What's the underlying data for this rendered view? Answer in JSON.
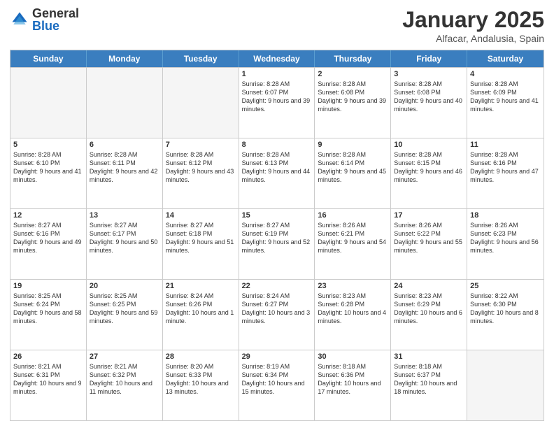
{
  "logo": {
    "general": "General",
    "blue": "Blue"
  },
  "title": "January 2025",
  "subtitle": "Alfacar, Andalusia, Spain",
  "weekdays": [
    "Sunday",
    "Monday",
    "Tuesday",
    "Wednesday",
    "Thursday",
    "Friday",
    "Saturday"
  ],
  "weeks": [
    [
      {
        "day": "",
        "info": ""
      },
      {
        "day": "",
        "info": ""
      },
      {
        "day": "",
        "info": ""
      },
      {
        "day": "1",
        "info": "Sunrise: 8:28 AM\nSunset: 6:07 PM\nDaylight: 9 hours and 39 minutes."
      },
      {
        "day": "2",
        "info": "Sunrise: 8:28 AM\nSunset: 6:08 PM\nDaylight: 9 hours and 39 minutes."
      },
      {
        "day": "3",
        "info": "Sunrise: 8:28 AM\nSunset: 6:08 PM\nDaylight: 9 hours and 40 minutes."
      },
      {
        "day": "4",
        "info": "Sunrise: 8:28 AM\nSunset: 6:09 PM\nDaylight: 9 hours and 41 minutes."
      }
    ],
    [
      {
        "day": "5",
        "info": "Sunrise: 8:28 AM\nSunset: 6:10 PM\nDaylight: 9 hours and 41 minutes."
      },
      {
        "day": "6",
        "info": "Sunrise: 8:28 AM\nSunset: 6:11 PM\nDaylight: 9 hours and 42 minutes."
      },
      {
        "day": "7",
        "info": "Sunrise: 8:28 AM\nSunset: 6:12 PM\nDaylight: 9 hours and 43 minutes."
      },
      {
        "day": "8",
        "info": "Sunrise: 8:28 AM\nSunset: 6:13 PM\nDaylight: 9 hours and 44 minutes."
      },
      {
        "day": "9",
        "info": "Sunrise: 8:28 AM\nSunset: 6:14 PM\nDaylight: 9 hours and 45 minutes."
      },
      {
        "day": "10",
        "info": "Sunrise: 8:28 AM\nSunset: 6:15 PM\nDaylight: 9 hours and 46 minutes."
      },
      {
        "day": "11",
        "info": "Sunrise: 8:28 AM\nSunset: 6:16 PM\nDaylight: 9 hours and 47 minutes."
      }
    ],
    [
      {
        "day": "12",
        "info": "Sunrise: 8:27 AM\nSunset: 6:16 PM\nDaylight: 9 hours and 49 minutes."
      },
      {
        "day": "13",
        "info": "Sunrise: 8:27 AM\nSunset: 6:17 PM\nDaylight: 9 hours and 50 minutes."
      },
      {
        "day": "14",
        "info": "Sunrise: 8:27 AM\nSunset: 6:18 PM\nDaylight: 9 hours and 51 minutes."
      },
      {
        "day": "15",
        "info": "Sunrise: 8:27 AM\nSunset: 6:19 PM\nDaylight: 9 hours and 52 minutes."
      },
      {
        "day": "16",
        "info": "Sunrise: 8:26 AM\nSunset: 6:21 PM\nDaylight: 9 hours and 54 minutes."
      },
      {
        "day": "17",
        "info": "Sunrise: 8:26 AM\nSunset: 6:22 PM\nDaylight: 9 hours and 55 minutes."
      },
      {
        "day": "18",
        "info": "Sunrise: 8:26 AM\nSunset: 6:23 PM\nDaylight: 9 hours and 56 minutes."
      }
    ],
    [
      {
        "day": "19",
        "info": "Sunrise: 8:25 AM\nSunset: 6:24 PM\nDaylight: 9 hours and 58 minutes."
      },
      {
        "day": "20",
        "info": "Sunrise: 8:25 AM\nSunset: 6:25 PM\nDaylight: 9 hours and 59 minutes."
      },
      {
        "day": "21",
        "info": "Sunrise: 8:24 AM\nSunset: 6:26 PM\nDaylight: 10 hours and 1 minute."
      },
      {
        "day": "22",
        "info": "Sunrise: 8:24 AM\nSunset: 6:27 PM\nDaylight: 10 hours and 3 minutes."
      },
      {
        "day": "23",
        "info": "Sunrise: 8:23 AM\nSunset: 6:28 PM\nDaylight: 10 hours and 4 minutes."
      },
      {
        "day": "24",
        "info": "Sunrise: 8:23 AM\nSunset: 6:29 PM\nDaylight: 10 hours and 6 minutes."
      },
      {
        "day": "25",
        "info": "Sunrise: 8:22 AM\nSunset: 6:30 PM\nDaylight: 10 hours and 8 minutes."
      }
    ],
    [
      {
        "day": "26",
        "info": "Sunrise: 8:21 AM\nSunset: 6:31 PM\nDaylight: 10 hours and 9 minutes."
      },
      {
        "day": "27",
        "info": "Sunrise: 8:21 AM\nSunset: 6:32 PM\nDaylight: 10 hours and 11 minutes."
      },
      {
        "day": "28",
        "info": "Sunrise: 8:20 AM\nSunset: 6:33 PM\nDaylight: 10 hours and 13 minutes."
      },
      {
        "day": "29",
        "info": "Sunrise: 8:19 AM\nSunset: 6:34 PM\nDaylight: 10 hours and 15 minutes."
      },
      {
        "day": "30",
        "info": "Sunrise: 8:18 AM\nSunset: 6:36 PM\nDaylight: 10 hours and 17 minutes."
      },
      {
        "day": "31",
        "info": "Sunrise: 8:18 AM\nSunset: 6:37 PM\nDaylight: 10 hours and 18 minutes."
      },
      {
        "day": "",
        "info": ""
      }
    ]
  ]
}
